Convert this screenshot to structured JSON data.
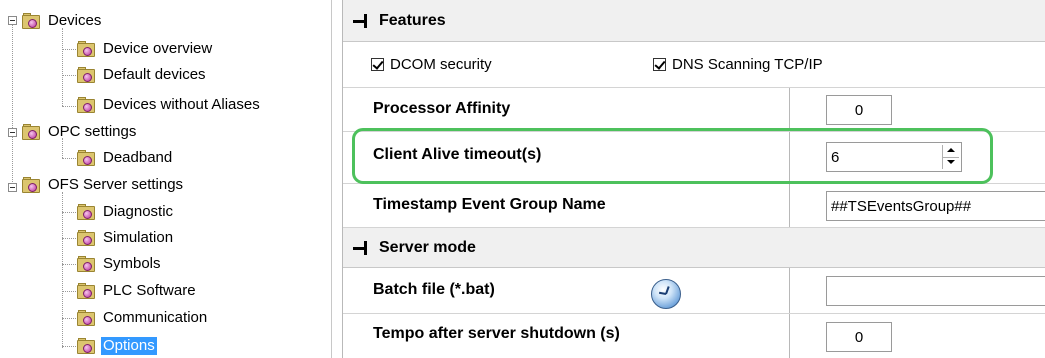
{
  "tree": {
    "groups": [
      {
        "label": "Devices",
        "children": [
          "Device overview",
          "Default devices",
          "Devices without Aliases"
        ]
      },
      {
        "label": "OPC settings",
        "children": [
          "Deadband"
        ]
      },
      {
        "label": "OFS Server settings",
        "children": [
          "Diagnostic",
          "Simulation",
          "Symbols",
          "PLC Software",
          "Communication",
          "Options"
        ]
      }
    ],
    "selected": "Options"
  },
  "features": {
    "title": "Features",
    "dcom_label": "DCOM security",
    "dcom_checked": true,
    "dns_label": "DNS Scanning TCP/IP",
    "dns_checked": true,
    "processor_affinity": {
      "label": "Processor Affinity",
      "value": "0"
    },
    "client_alive": {
      "label": "Client Alive timeout(s)",
      "value": "6"
    },
    "timestamp_group": {
      "label": "Timestamp Event Group Name",
      "value": "##TSEventsGroup##"
    }
  },
  "server_mode": {
    "title": "Server mode",
    "batch_file": {
      "label": "Batch file (*.bat)",
      "value": "",
      "icon": "clock-icon"
    },
    "tempo": {
      "label": "Tempo after server shutdown (s)",
      "value": "0"
    }
  },
  "colors": {
    "highlight": "#4dc15c",
    "selection": "#3399ff"
  }
}
